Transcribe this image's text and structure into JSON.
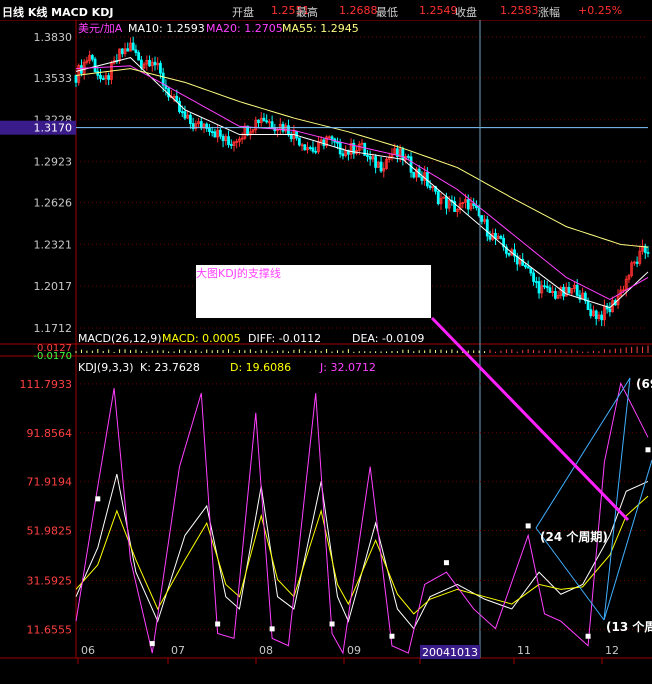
{
  "header": {
    "chart_name": "日线 K线 MACD KDJ",
    "open_label": "开盘",
    "open_value": "1.2551",
    "high_label": "最高",
    "high_value": "1.2688",
    "low_label": "最低",
    "low_value": "1.2549",
    "close_label": "收盘",
    "close_value": "1.2583",
    "change_label": "涨幅",
    "change_value": "+0.25%"
  },
  "price_panel": {
    "symbol": "美元/加A",
    "ma10_label": "MA10: 1.2593",
    "ma20_label": "MA20: 1.2705",
    "ma55_label": "MA55: 1.2945",
    "cursor_value": "1.3170"
  },
  "macd_panel": {
    "title": "MACD(26,12,9)",
    "macd_label": "MACD: 0.0005",
    "diff_label": "DIFF: -0.0112",
    "dea_label": "DEA: -0.0109",
    "ytick_top": "0.0127",
    "ytick_bottom": "-0.0170"
  },
  "kdj_panel": {
    "title": "KDJ(9,3,3)",
    "k_label": "K: 23.7628",
    "d_label": "D: 19.6086",
    "j_label": "J: 32.0712"
  },
  "annotations": {
    "support_note": "大图KDJ的支撑线",
    "cycle_24": "(24 个周期)",
    "cycle_13": "(13 个周",
    "cycle_69": "(69"
  },
  "colors": {
    "background": "#000000",
    "up_candle": "#ff3030",
    "down_candle": "#00ffff",
    "ma10": "#ffffff",
    "ma20": "#ff40ff",
    "ma55": "#ffff80",
    "k_line": "#ffffff",
    "d_line": "#ffff00",
    "j_line": "#ff40ff",
    "trend_line": "#ff20ff",
    "cycle_line": "#40b0ff"
  },
  "chart_data": [
    {
      "type": "candlestick",
      "title": "美元/加A",
      "x_ticks": [
        "06",
        "07",
        "08",
        "09",
        "20041013",
        "11",
        "12"
      ],
      "y_ticks": [
        1.383,
        1.3533,
        1.3228,
        1.2923,
        1.2626,
        1.2321,
        1.2017,
        1.1712
      ],
      "ylim": [
        1.1712,
        1.383
      ],
      "grid": true,
      "close_path": [
        [
          0,
          1.355
        ],
        [
          5,
          1.37
        ],
        [
          10,
          1.348
        ],
        [
          16,
          1.37
        ],
        [
          20,
          1.376
        ],
        [
          24,
          1.364
        ],
        [
          28,
          1.368
        ],
        [
          32,
          1.35
        ],
        [
          36,
          1.335
        ],
        [
          40,
          1.323
        ],
        [
          44,
          1.318
        ],
        [
          48,
          1.32
        ],
        [
          52,
          1.312
        ],
        [
          56,
          1.305
        ],
        [
          60,
          1.312
        ],
        [
          64,
          1.318
        ],
        [
          68,
          1.325
        ],
        [
          72,
          1.32
        ],
        [
          76,
          1.318
        ],
        [
          80,
          1.312
        ],
        [
          84,
          1.305
        ],
        [
          88,
          1.3
        ],
        [
          92,
          1.31
        ],
        [
          96,
          1.302
        ],
        [
          100,
          1.3
        ],
        [
          104,
          1.305
        ],
        [
          108,
          1.292
        ],
        [
          112,
          1.29
        ],
        [
          116,
          1.298
        ],
        [
          120,
          1.296
        ],
        [
          124,
          1.286
        ],
        [
          128,
          1.28
        ],
        [
          132,
          1.268
        ],
        [
          136,
          1.262
        ],
        [
          140,
          1.258
        ],
        [
          144,
          1.262
        ],
        [
          148,
          1.252
        ],
        [
          152,
          1.24
        ],
        [
          156,
          1.232
        ],
        [
          160,
          1.224
        ],
        [
          164,
          1.22
        ],
        [
          168,
          1.205
        ],
        [
          172,
          1.198
        ],
        [
          176,
          1.196
        ],
        [
          180,
          1.196
        ],
        [
          184,
          1.2
        ],
        [
          188,
          1.185
        ],
        [
          192,
          1.18
        ],
        [
          196,
          1.185
        ],
        [
          200,
          1.198
        ],
        [
          204,
          1.215
        ],
        [
          208,
          1.226
        ],
        [
          210,
          1.228
        ]
      ],
      "series": [
        {
          "name": "MA10",
          "last": 1.2593,
          "path": [
            [
              0,
              1.358
            ],
            [
              20,
              1.368
            ],
            [
              40,
              1.33
            ],
            [
              60,
              1.312
            ],
            [
              80,
              1.312
            ],
            [
              100,
              1.3
            ],
            [
              120,
              1.294
            ],
            [
              140,
              1.26
            ],
            [
              160,
              1.226
            ],
            [
              180,
              1.196
            ],
            [
              196,
              1.186
            ],
            [
              210,
              1.212
            ]
          ]
        },
        {
          "name": "MA20",
          "last": 1.2705,
          "path": [
            [
              0,
              1.36
            ],
            [
              20,
              1.362
            ],
            [
              40,
              1.34
            ],
            [
              60,
              1.318
            ],
            [
              80,
              1.315
            ],
            [
              100,
              1.305
            ],
            [
              120,
              1.296
            ],
            [
              140,
              1.272
            ],
            [
              160,
              1.24
            ],
            [
              180,
              1.208
            ],
            [
              196,
              1.192
            ],
            [
              210,
              1.208
            ]
          ]
        },
        {
          "name": "MA55",
          "last": 1.2945,
          "path": [
            [
              0,
              1.355
            ],
            [
              20,
              1.36
            ],
            [
              40,
              1.35
            ],
            [
              60,
              1.336
            ],
            [
              80,
              1.324
            ],
            [
              100,
              1.314
            ],
            [
              120,
              1.302
            ],
            [
              140,
              1.288
            ],
            [
              160,
              1.266
            ],
            [
              180,
              1.245
            ],
            [
              200,
              1.232
            ],
            [
              210,
              1.23
            ]
          ]
        }
      ]
    },
    {
      "type": "histogram",
      "title": "MACD(26,12,9)",
      "y_ticks": [
        0.0127,
        -0.017
      ],
      "values": {
        "MACD": 0.0005,
        "DIFF": -0.0112,
        "DEA": -0.0109
      }
    },
    {
      "type": "line",
      "title": "KDJ(9,3,3)",
      "y_ticks": [
        111.7933,
        91.8564,
        71.9194,
        51.9825,
        31.5925,
        11.6555
      ],
      "ylim": [
        0,
        115
      ],
      "x_ticks": [
        "06",
        "07",
        "08",
        "09",
        "20041013",
        "11",
        "12"
      ],
      "series": [
        {
          "name": "K",
          "last": 23.7628,
          "path": [
            [
              0,
              25
            ],
            [
              8,
              45
            ],
            [
              15,
              75
            ],
            [
              22,
              35
            ],
            [
              30,
              15
            ],
            [
              40,
              50
            ],
            [
              48,
              62
            ],
            [
              55,
              25
            ],
            [
              60,
              20
            ],
            [
              68,
              70
            ],
            [
              74,
              25
            ],
            [
              80,
              20
            ],
            [
              90,
              72
            ],
            [
              96,
              25
            ],
            [
              100,
              15
            ],
            [
              110,
              55
            ],
            [
              118,
              20
            ],
            [
              124,
              12
            ],
            [
              130,
              25
            ],
            [
              140,
              30
            ],
            [
              150,
              24
            ],
            [
              160,
              20
            ],
            [
              170,
              35
            ],
            [
              178,
              26
            ],
            [
              186,
              30
            ],
            [
              196,
              50
            ],
            [
              202,
              68
            ],
            [
              210,
              72
            ]
          ]
        },
        {
          "name": "D",
          "last": 19.6086,
          "path": [
            [
              0,
              28
            ],
            [
              8,
              38
            ],
            [
              15,
              60
            ],
            [
              22,
              40
            ],
            [
              30,
              20
            ],
            [
              40,
              40
            ],
            [
              48,
              55
            ],
            [
              55,
              30
            ],
            [
              60,
              25
            ],
            [
              68,
              58
            ],
            [
              74,
              32
            ],
            [
              80,
              25
            ],
            [
              90,
              60
            ],
            [
              96,
              30
            ],
            [
              100,
              22
            ],
            [
              110,
              48
            ],
            [
              118,
              26
            ],
            [
              124,
              18
            ],
            [
              130,
              24
            ],
            [
              140,
              28
            ],
            [
              150,
              25
            ],
            [
              160,
              22
            ],
            [
              170,
              30
            ],
            [
              178,
              28
            ],
            [
              186,
              29
            ],
            [
              196,
              42
            ],
            [
              202,
              58
            ],
            [
              210,
              66
            ]
          ]
        },
        {
          "name": "J",
          "last": 32.0712,
          "path": [
            [
              0,
              15
            ],
            [
              8,
              70
            ],
            [
              14,
              110
            ],
            [
              20,
              40
            ],
            [
              28,
              2
            ],
            [
              38,
              78
            ],
            [
              46,
              108
            ],
            [
              52,
              10
            ],
            [
              58,
              8
            ],
            [
              66,
              100
            ],
            [
              72,
              8
            ],
            [
              78,
              5
            ],
            [
              88,
              108
            ],
            [
              94,
              10
            ],
            [
              98,
              2
            ],
            [
              108,
              78
            ],
            [
              116,
              5
            ],
            [
              122,
              2
            ],
            [
              128,
              30
            ],
            [
              136,
              35
            ],
            [
              146,
              20
            ],
            [
              154,
              12
            ],
            [
              166,
              50
            ],
            [
              172,
              18
            ],
            [
              178,
              15
            ],
            [
              188,
              5
            ],
            [
              194,
              80
            ],
            [
              200,
              112
            ],
            [
              210,
              90
            ]
          ]
        }
      ]
    }
  ]
}
